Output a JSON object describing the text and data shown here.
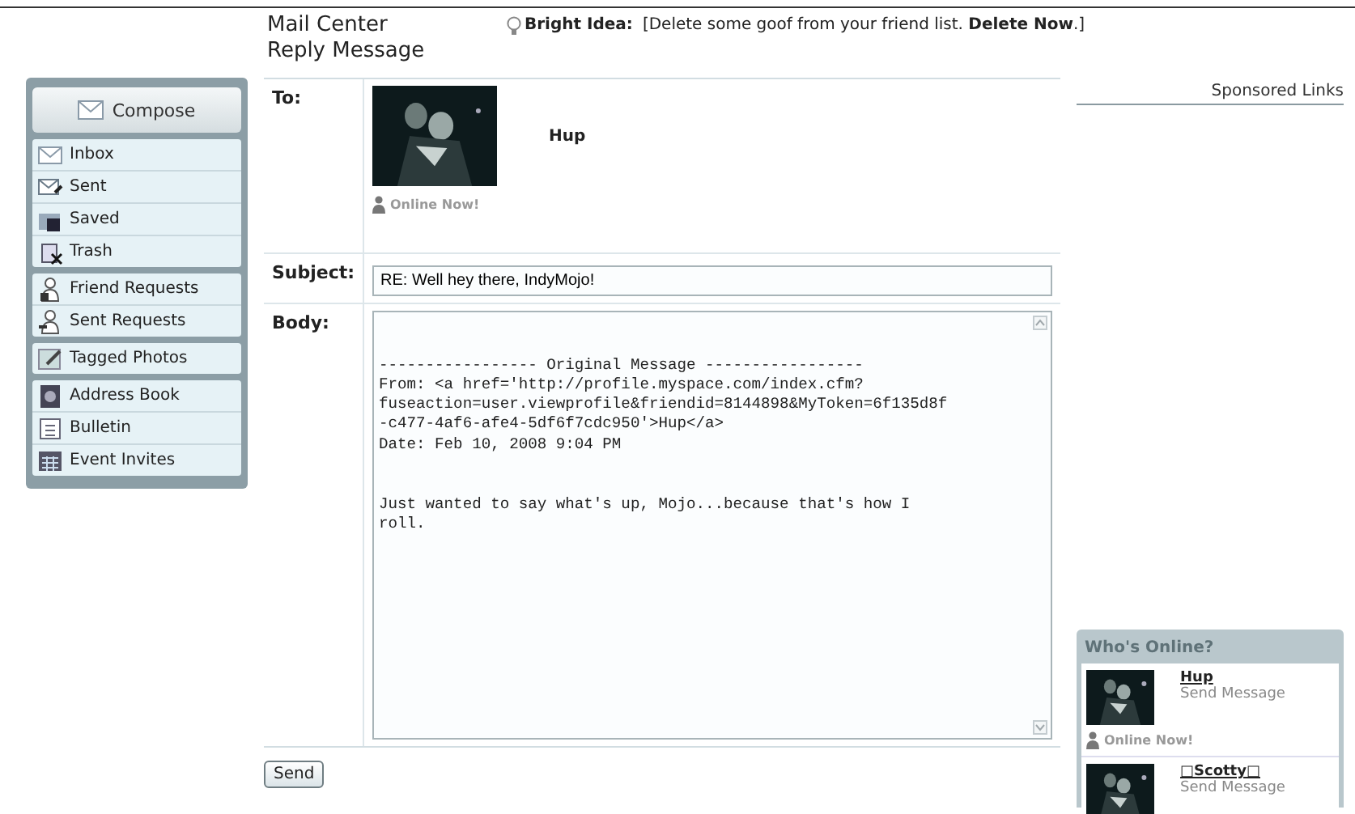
{
  "header": {
    "title": "Mail Center",
    "subtitle": "Reply Message",
    "tip_label": "Bright Idea:",
    "tip_text": "[Delete some goof from your friend list. **Delete Now**.]"
  },
  "sidebar": {
    "compose": "Compose",
    "groups": [
      {
        "items": [
          {
            "label": "Inbox"
          },
          {
            "label": "Sent"
          },
          {
            "label": "Saved"
          },
          {
            "label": "Trash"
          }
        ]
      },
      {
        "items": [
          {
            "label": "Friend Requests"
          },
          {
            "label": "Sent Requests"
          }
        ]
      },
      {
        "items": [
          {
            "label": "Tagged Photos"
          }
        ]
      },
      {
        "items": [
          {
            "label": "Address Book"
          },
          {
            "label": "Bulletin"
          },
          {
            "label": "Event Invites"
          }
        ]
      }
    ]
  },
  "form": {
    "to_label": "To:",
    "recipient": {
      "name": "Hup",
      "status": "Online Now!"
    },
    "subject_label": "Subject:",
    "subject": "RE: Well hey there, IndyMojo!",
    "body_label": "Body:",
    "body": "\n\n----------------- Original Message -----------------\nFrom: <a href='http://profile.myspace.com/index.cfm?\nfuseaction=user.viewprofile&friendid=8144898&MyToken=6f135d8f\n-c477-4af6-afe4-5df6f7cdc950'>Hup</a>\nDate: Feb 10, 2008 9:04 PM\n\n\nJust wanted to say what's up, Mojo...because that's how I\nroll.",
    "send": "Send"
  },
  "sponsored": "Sponsored Links",
  "whos_online": {
    "title": "Who's Online?",
    "people": [
      {
        "name": "Hup",
        "action": "Send Message",
        "online": true,
        "status": "Online Now!"
      },
      {
        "name": "□Scotty□",
        "action": "Send Message",
        "online": false
      }
    ]
  }
}
